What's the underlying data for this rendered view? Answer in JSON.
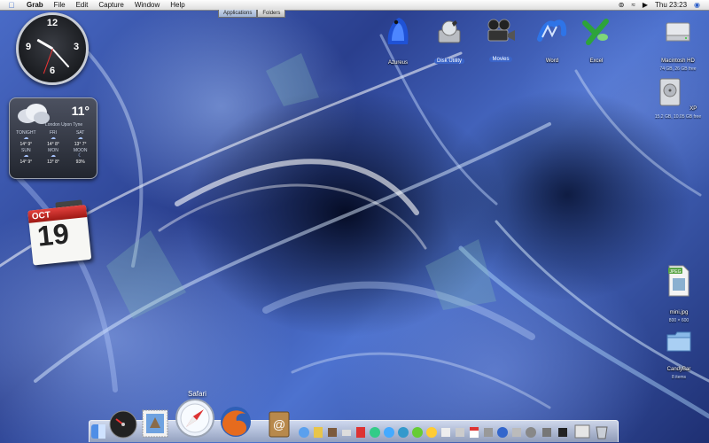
{
  "menubar": {
    "apple_icon": "apple-icon",
    "items": [
      {
        "label": "Grab",
        "bold": true
      },
      {
        "label": "File"
      },
      {
        "label": "Edit"
      },
      {
        "label": "Capture"
      },
      {
        "label": "Window"
      },
      {
        "label": "Help"
      }
    ],
    "clock": "Thu 23:23"
  },
  "finder_tabs": [
    "Applications",
    "Folders"
  ],
  "weather": {
    "temp": "11°",
    "location": "London Upon Tyne",
    "days": [
      {
        "day": "TONIGHT",
        "temp": "14°  9°"
      },
      {
        "day": "FRI",
        "temp": "14°  8°"
      },
      {
        "day": "SAT",
        "temp": "13°  7°"
      },
      {
        "day": "SUN",
        "temp": "14°  9°"
      },
      {
        "day": "MON",
        "temp": "13°  8°"
      },
      {
        "day": "MOON",
        "temp": "93%"
      }
    ]
  },
  "ical": {
    "month": "OCT",
    "day": "19"
  },
  "desktop_icons": {
    "azureus": "Azureus",
    "disk_utility": "Disk Utility",
    "movies": "Movies",
    "word": "Word",
    "excel": "Excel",
    "macintosh_hd": {
      "name": "Macintosh HD",
      "info": "74 GB, 26 GB free"
    },
    "xp": {
      "name": "XP",
      "info": "15.2 GB, 10.05 GB free"
    },
    "mini_jpg": {
      "name": "mini.jpg",
      "info": "800 × 600",
      "badge": "JPEG"
    },
    "candybar": {
      "name": "CandyBar",
      "info": "8 items"
    }
  },
  "dock": {
    "hover_label": "Safari"
  },
  "colors": {
    "menubar_top": "#fdfdfd",
    "selection": "#3a64c8",
    "ical_red": "#c52c27"
  }
}
